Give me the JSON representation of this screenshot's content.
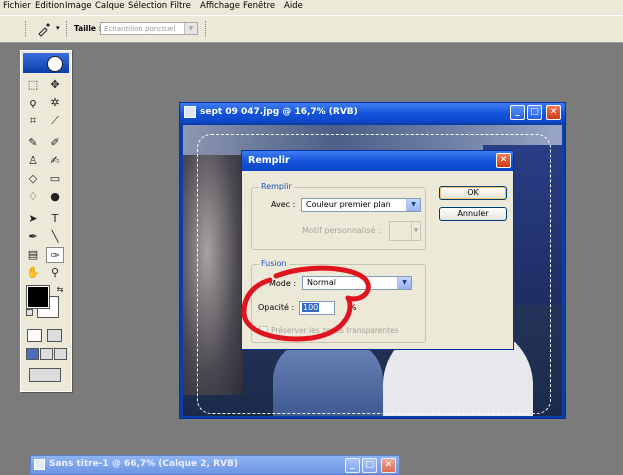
{
  "menu": [
    "Fichier",
    "Edition",
    "Image",
    "Calque",
    "Sélection",
    "Filtre",
    "Affichage",
    "Fenêtre",
    "Aide"
  ],
  "options_bar": {
    "size_label": "Taille :",
    "size_value": "Echantillon ponctuel"
  },
  "document_window": {
    "title": "sept 09 047.jpg @ 16,7% (RVB)"
  },
  "dialog": {
    "title": "Remplir",
    "fill_group": {
      "legend": "Remplir",
      "use_label": "Avec :",
      "use_value": "Couleur premier plan",
      "custom_pattern_label": "Motif personnalisé :"
    },
    "blend_group": {
      "legend": "Fusion",
      "mode_label": "Mode :",
      "mode_value": "Normal",
      "opacity_label": "Opacité :",
      "opacity_value": "100",
      "opacity_unit": "%",
      "preserve_transparency_label": "Préserver les zones transparentes"
    },
    "ok_label": "OK",
    "cancel_label": "Annuler"
  },
  "second_window": {
    "title": "Sans titre-1 @ 66,7% (Calque 2, RVB)"
  },
  "colors": {
    "title_bar": "#1252d8",
    "close_button": "#cc3a16",
    "annotation_red": "#e0141e",
    "app_background": "#7b7b7b"
  }
}
